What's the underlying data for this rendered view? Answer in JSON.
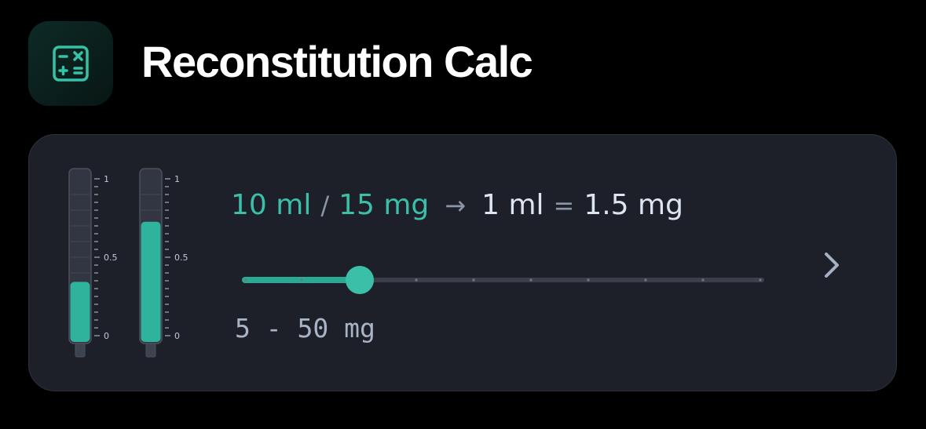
{
  "header": {
    "title": "Reconstitution Calc",
    "icon": "calculator-icon"
  },
  "card": {
    "syringes": [
      {
        "fill_fraction": 0.35,
        "labels": {
          "top": "1",
          "mid": "0.5",
          "bottom": "0"
        }
      },
      {
        "fill_fraction": 0.7,
        "labels": {
          "top": "1",
          "mid": "0.5",
          "bottom": "0"
        }
      }
    ],
    "formula": {
      "volume": "10 ml",
      "separator": "/",
      "amount": "15 mg",
      "arrow": "→",
      "unit_volume": "1 ml",
      "equals": "=",
      "concentration": "1.5 mg"
    },
    "slider": {
      "min": 5,
      "max": 50,
      "value": 15,
      "step": 5,
      "range_label": "5 - 50 mg"
    },
    "chevron": "chevron-right-icon"
  },
  "colors": {
    "background": "#000000",
    "card": "#1d2028",
    "accent": "#3bbfa8",
    "text_primary": "#dde5f2",
    "text_muted": "#8a95a8"
  }
}
